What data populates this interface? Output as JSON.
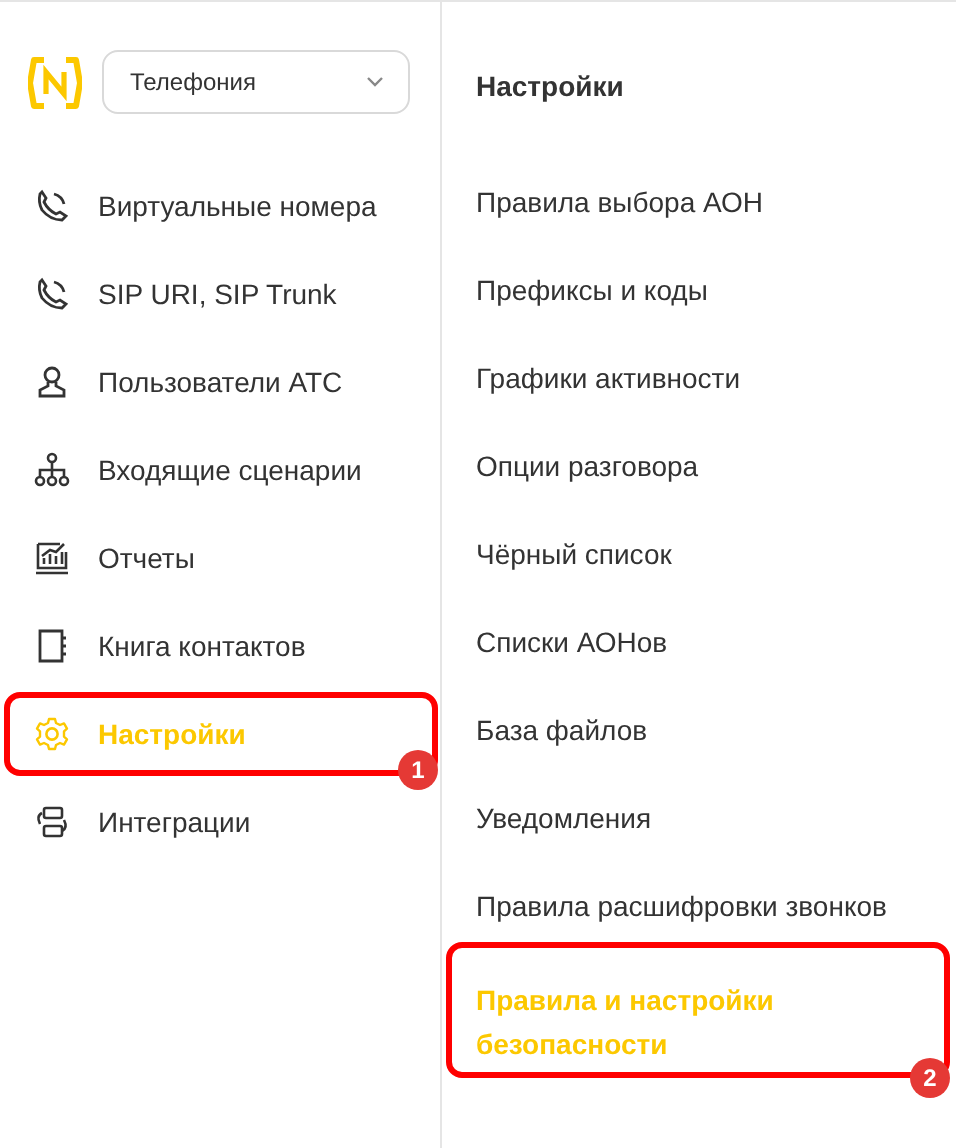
{
  "product_select": {
    "value": "Телефония"
  },
  "nav": [
    {
      "label": "Виртуальные номера",
      "kind": "phone",
      "selected": false
    },
    {
      "label": "SIP URI, SIP Trunk",
      "kind": "phone",
      "selected": false
    },
    {
      "label": "Пользователи АТС",
      "kind": "user",
      "selected": false
    },
    {
      "label": "Входящие сценарии",
      "kind": "tree",
      "selected": false
    },
    {
      "label": "Отчеты",
      "kind": "chart",
      "selected": false
    },
    {
      "label": "Книга контактов",
      "kind": "book",
      "selected": false
    },
    {
      "label": "Настройки",
      "kind": "gear",
      "selected": true,
      "callout": "1"
    },
    {
      "label": "Интеграции",
      "kind": "sync",
      "selected": false
    }
  ],
  "submenu": {
    "title": "Настройки",
    "items": [
      {
        "label": "Правила выбора АОН",
        "selected": false
      },
      {
        "label": "Префиксы и коды",
        "selected": false
      },
      {
        "label": "Графики активности",
        "selected": false
      },
      {
        "label": "Опции разговора",
        "selected": false
      },
      {
        "label": "Чёрный список",
        "selected": false
      },
      {
        "label": "Списки АОНов",
        "selected": false
      },
      {
        "label": "База файлов",
        "selected": false
      },
      {
        "label": "Уведомления",
        "selected": false
      },
      {
        "label": "Правила расшифровки звонков",
        "selected": false
      },
      {
        "label": "Правила и настройки безопасности",
        "selected": true,
        "callout": "2"
      }
    ]
  }
}
